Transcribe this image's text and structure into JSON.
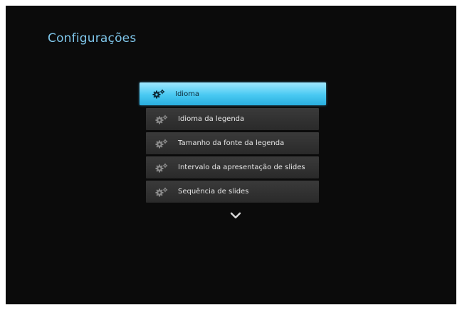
{
  "page": {
    "title": "Configurações"
  },
  "menu": {
    "items": [
      {
        "label": "Idioma",
        "icon": "gear-icon",
        "selected": true
      },
      {
        "label": "Idioma da legenda",
        "icon": "gear-icon",
        "selected": false
      },
      {
        "label": "Tamanho da fonte da legenda",
        "icon": "gear-icon",
        "selected": false
      },
      {
        "label": "Intervalo da apresentação de slides",
        "icon": "gear-icon",
        "selected": false
      },
      {
        "label": "Sequência de slides",
        "icon": "gear-icon",
        "selected": false
      }
    ],
    "more_indicator": "chevron-down-icon"
  },
  "colors": {
    "title": "#7fc6ea",
    "highlight": "#49c9f2",
    "item_background": "#333333",
    "screen_background": "#0b0b0b"
  }
}
